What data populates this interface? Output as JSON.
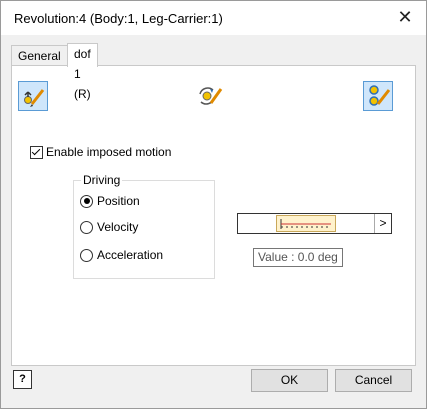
{
  "window": {
    "title": "Revolution:4 (Body:1, Leg-Carrier:1)"
  },
  "tabs": [
    {
      "label": "General"
    },
    {
      "label": "dof 1 (R)"
    }
  ],
  "icons": {
    "left": "position-pencil-icon",
    "middle": "rotation-pencil-icon",
    "right": "joint-pencil-icon"
  },
  "enable_motion": {
    "label": "Enable imposed motion",
    "checked": true
  },
  "driving": {
    "label": "Driving",
    "options": [
      {
        "label": "Position",
        "selected": true
      },
      {
        "label": "Velocity",
        "selected": false
      },
      {
        "label": "Acceleration",
        "selected": false
      }
    ]
  },
  "slider": {
    "arrow": ">",
    "tooltip": "Value : 0.0 deg"
  },
  "buttons": {
    "help": "?",
    "ok": "OK",
    "cancel": "Cancel"
  },
  "colors": {
    "accent": "#5a9bd5",
    "thumb": "#fff2cc"
  }
}
